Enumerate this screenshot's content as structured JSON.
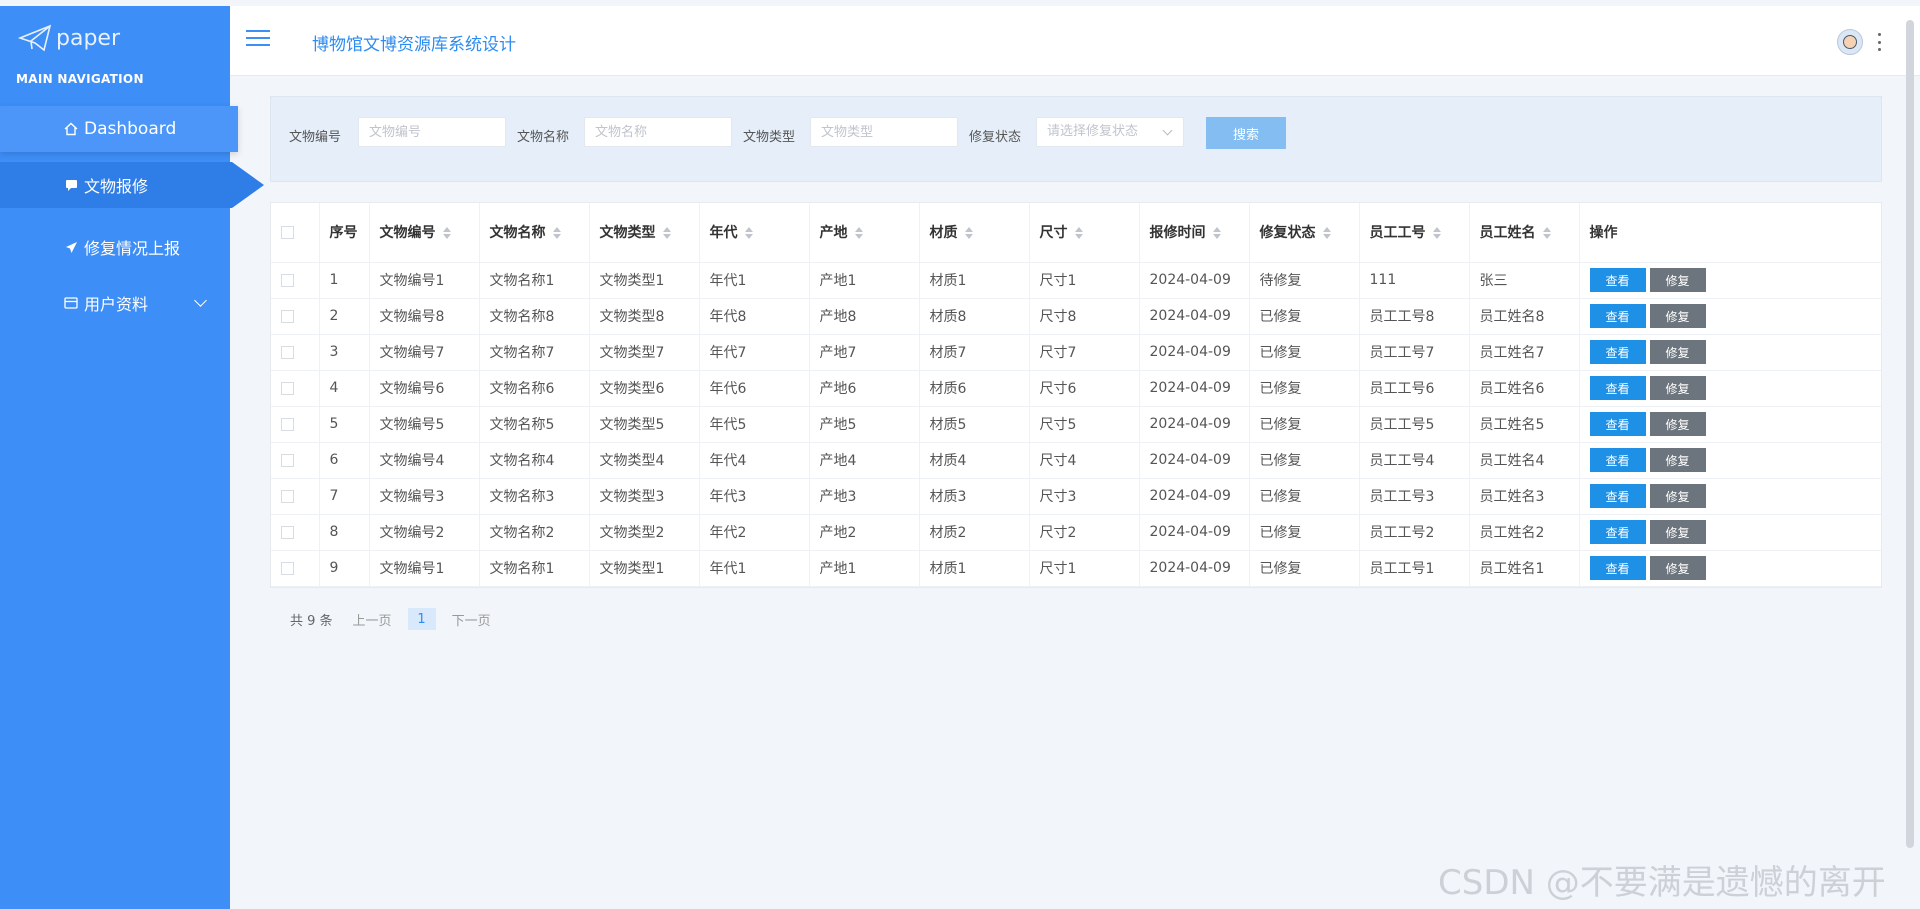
{
  "sidebar": {
    "brand": "paper",
    "nav_title": "MAIN NAVIGATION",
    "items": [
      {
        "label": "Dashboard",
        "icon": "home-icon"
      },
      {
        "label": "文物报修",
        "icon": "chat-icon"
      },
      {
        "label": "修复情况上报",
        "icon": "send-icon"
      },
      {
        "label": "用户资料",
        "icon": "card-icon"
      }
    ]
  },
  "header": {
    "title": "博物馆文博资源库系统设计"
  },
  "search": {
    "label1": "文物编号",
    "placeholder1": "文物编号",
    "label2": "文物名称",
    "placeholder2": "文物名称",
    "label3": "文物类型",
    "placeholder3": "文物类型",
    "label4": "修复状态",
    "placeholder4": "请选择修复状态",
    "button": "搜索"
  },
  "table": {
    "headers": [
      "序号",
      "文物编号",
      "文物名称",
      "文物类型",
      "年代",
      "产地",
      "材质",
      "尺寸",
      "报修时间",
      "修复状态",
      "员工工号",
      "员工姓名",
      "操作"
    ],
    "view_label": "查看",
    "fix_label": "修复",
    "rows": [
      [
        "1",
        "文物编号1",
        "文物名称1",
        "文物类型1",
        "年代1",
        "产地1",
        "材质1",
        "尺寸1",
        "2024-04-09",
        "待修复",
        "111",
        "张三"
      ],
      [
        "2",
        "文物编号8",
        "文物名称8",
        "文物类型8",
        "年代8",
        "产地8",
        "材质8",
        "尺寸8",
        "2024-04-09",
        "已修复",
        "员工工号8",
        "员工姓名8"
      ],
      [
        "3",
        "文物编号7",
        "文物名称7",
        "文物类型7",
        "年代7",
        "产地7",
        "材质7",
        "尺寸7",
        "2024-04-09",
        "已修复",
        "员工工号7",
        "员工姓名7"
      ],
      [
        "4",
        "文物编号6",
        "文物名称6",
        "文物类型6",
        "年代6",
        "产地6",
        "材质6",
        "尺寸6",
        "2024-04-09",
        "已修复",
        "员工工号6",
        "员工姓名6"
      ],
      [
        "5",
        "文物编号5",
        "文物名称5",
        "文物类型5",
        "年代5",
        "产地5",
        "材质5",
        "尺寸5",
        "2024-04-09",
        "已修复",
        "员工工号5",
        "员工姓名5"
      ],
      [
        "6",
        "文物编号4",
        "文物名称4",
        "文物类型4",
        "年代4",
        "产地4",
        "材质4",
        "尺寸4",
        "2024-04-09",
        "已修复",
        "员工工号4",
        "员工姓名4"
      ],
      [
        "7",
        "文物编号3",
        "文物名称3",
        "文物类型3",
        "年代3",
        "产地3",
        "材质3",
        "尺寸3",
        "2024-04-09",
        "已修复",
        "员工工号3",
        "员工姓名3"
      ],
      [
        "8",
        "文物编号2",
        "文物名称2",
        "文物类型2",
        "年代2",
        "产地2",
        "材质2",
        "尺寸2",
        "2024-04-09",
        "已修复",
        "员工工号2",
        "员工姓名2"
      ],
      [
        "9",
        "文物编号1",
        "文物名称1",
        "文物类型1",
        "年代1",
        "产地1",
        "材质1",
        "尺寸1",
        "2024-04-09",
        "已修复",
        "员工工号1",
        "员工姓名1"
      ]
    ]
  },
  "pager": {
    "total": "共 9 条",
    "prev": "上一页",
    "current": "1",
    "next": "下一页"
  },
  "watermark": "CSDN @不要满是遗憾的离开",
  "colors": {
    "sidebar": "#3e8ef7",
    "accent": "#2d8cf0",
    "view_button": "#1e90e6",
    "fix_button": "#6c757d"
  }
}
